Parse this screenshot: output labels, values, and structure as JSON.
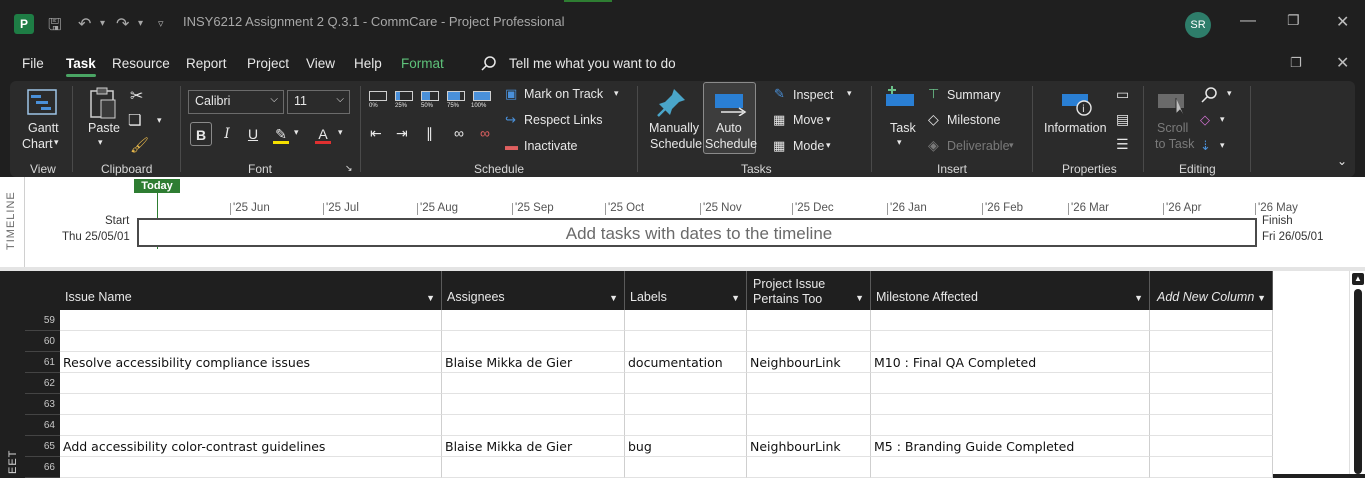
{
  "titlebar": {
    "title": "INSY6212 Assignment 2 Q.3.1 - CommCare  -  Project Professional",
    "user_initials": "SR",
    "app_letter": "P"
  },
  "menu": {
    "items": [
      "File",
      "Task",
      "Resource",
      "Report",
      "Project",
      "View",
      "Help",
      "Format"
    ],
    "active": "Task",
    "search_text": "Tell me what you want to do"
  },
  "ribbon": {
    "view": {
      "gantt_label_1": "Gantt",
      "gantt_label_2": "Chart",
      "group": "View"
    },
    "clipboard": {
      "paste": "Paste",
      "group": "Clipboard"
    },
    "font": {
      "family": "Calibri",
      "size": "11",
      "group": "Font",
      "bold": "B",
      "italic": "I",
      "underline": "U",
      "font_color": "A"
    },
    "schedule": {
      "mark_on_track": "Mark on Track",
      "respect_links": "Respect Links",
      "inactivate": "Inactivate",
      "group": "Schedule",
      "pct": [
        "0%",
        "25%",
        "50%",
        "75%",
        "100%"
      ]
    },
    "tasks": {
      "manually_1": "Manually",
      "manually_2": "Schedule",
      "auto_1": "Auto",
      "auto_2": "Schedule",
      "inspect": "Inspect",
      "move": "Move",
      "mode": "Mode",
      "group": "Tasks"
    },
    "insert": {
      "task": "Task",
      "summary": "Summary",
      "milestone": "Milestone",
      "deliverable": "Deliverable",
      "group": "Insert"
    },
    "properties": {
      "information": "Information",
      "group": "Properties"
    },
    "editing": {
      "scroll_1": "Scroll",
      "scroll_2": "to Task",
      "group": "Editing"
    }
  },
  "timeline": {
    "side_label": "TIMELINE",
    "today": "Today",
    "months": [
      "'25 Jun",
      "'25 Jul",
      "'25 Aug",
      "'25 Sep",
      "'25 Oct",
      "'25 Nov",
      "'25 Dec",
      "'26 Jan",
      "'26 Feb",
      "'26 Mar",
      "'26 Apr",
      "'26 May"
    ],
    "start_label": "Start",
    "start_date": "Thu 25/05/01",
    "finish_label": "Finish",
    "finish_date": "Fri 26/05/01",
    "placeholder": "Add tasks with dates to the timeline"
  },
  "sheet": {
    "side_label": "EET",
    "columns": [
      "Issue Name",
      "Assignees",
      "Labels",
      "Project Issue Pertains Too",
      "Milestone Affected",
      "Add New Column"
    ],
    "column_line1": "Project Issue",
    "column_line2": "Pertains Too",
    "rows": [
      {
        "num": "59",
        "cells": [
          "",
          "",
          "",
          "",
          ""
        ]
      },
      {
        "num": "60",
        "cells": [
          "",
          "",
          "",
          "",
          ""
        ]
      },
      {
        "num": "61",
        "cells": [
          "Resolve accessibility compliance issues",
          "Blaise Mikka de Gier",
          "documentation",
          "NeighbourLink",
          "M10 : Final QA Completed"
        ]
      },
      {
        "num": "62",
        "cells": [
          "",
          "",
          "",
          "",
          ""
        ]
      },
      {
        "num": "63",
        "cells": [
          "",
          "",
          "",
          "",
          ""
        ]
      },
      {
        "num": "64",
        "cells": [
          "",
          "",
          "",
          "",
          ""
        ]
      },
      {
        "num": "65",
        "cells": [
          "Add accessibility color-contrast guidelines",
          "Blaise Mikka de Gier",
          "bug",
          "NeighbourLink",
          "M5 : Branding Guide Completed"
        ]
      },
      {
        "num": "66",
        "cells": [
          "",
          "",
          "",
          "",
          ""
        ]
      }
    ]
  },
  "colors": {
    "accent": "#2e7d32",
    "format_tab": "#5ec27a",
    "background": "#1f1f1f",
    "ribbon": "#2b2b2b"
  }
}
